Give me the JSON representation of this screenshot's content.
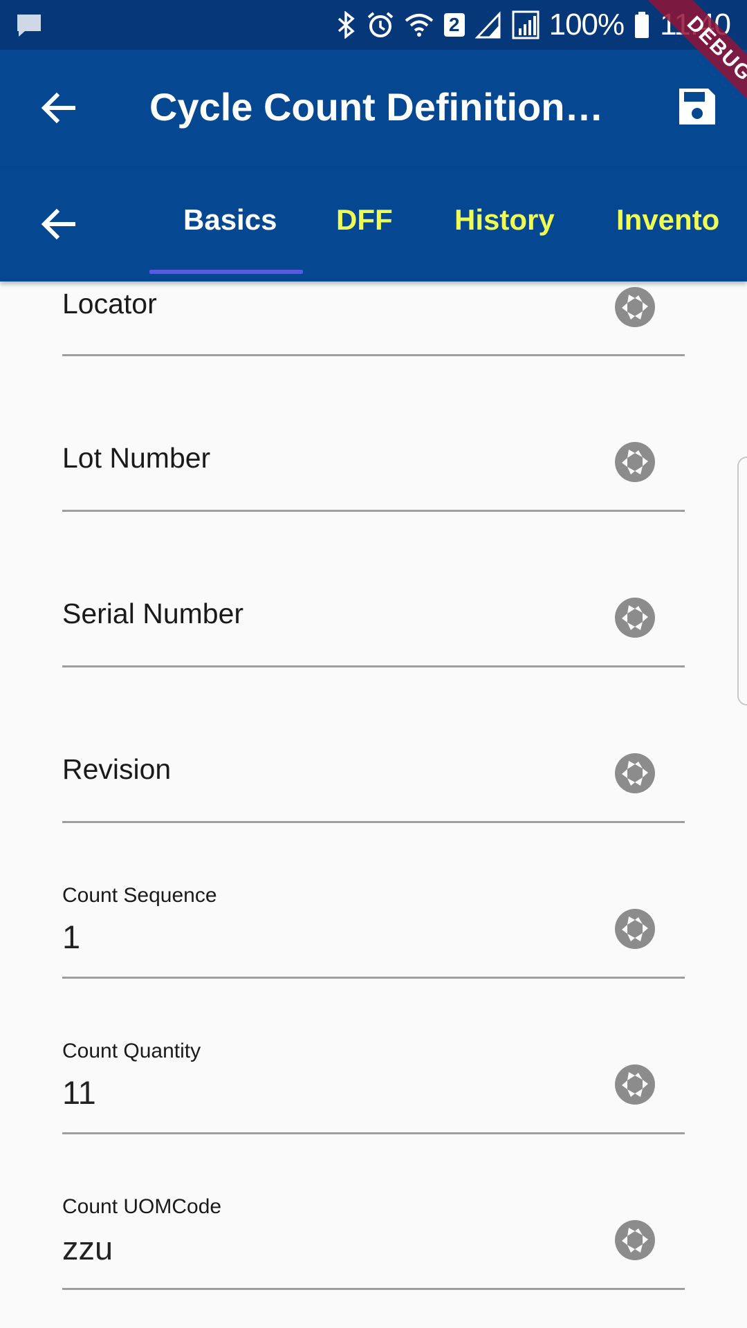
{
  "status_bar": {
    "battery": "100%",
    "time": "11:40",
    "sim_badge": "2",
    "icons": [
      "message-icon",
      "bluetooth-icon",
      "alarm-icon",
      "wifi-icon",
      "signal-icon",
      "battery-icon"
    ]
  },
  "debug_banner": "DEBUG",
  "app_bar": {
    "title": "Cycle Count Definitions Form",
    "back_icon": "arrow-back-icon",
    "save_icon": "save-icon"
  },
  "tabs": {
    "back_icon": "arrow-back-icon",
    "items": [
      {
        "label": "Basics",
        "active": true
      },
      {
        "label": "DFF",
        "active": false
      },
      {
        "label": "History",
        "active": false
      },
      {
        "label": "Invento",
        "active": false
      }
    ],
    "active_color": "#ffffff",
    "inactive_color": "#eefc54",
    "indicator_color": "#5a57e0"
  },
  "form": {
    "fields": [
      {
        "label": "Locator",
        "value": ""
      },
      {
        "label": "Lot Number",
        "value": ""
      },
      {
        "label": "Serial Number",
        "value": ""
      },
      {
        "label": "Revision",
        "value": ""
      },
      {
        "label": "Count Sequence",
        "value": "1"
      },
      {
        "label": "Count Quantity",
        "value": "11"
      },
      {
        "label": "Count UOMCode",
        "value": "zzu"
      }
    ],
    "field_icon": "camera-shutter-icon"
  },
  "colors": {
    "status_bar": "#063778",
    "app_bar": "#064791",
    "background": "#fafafa"
  }
}
